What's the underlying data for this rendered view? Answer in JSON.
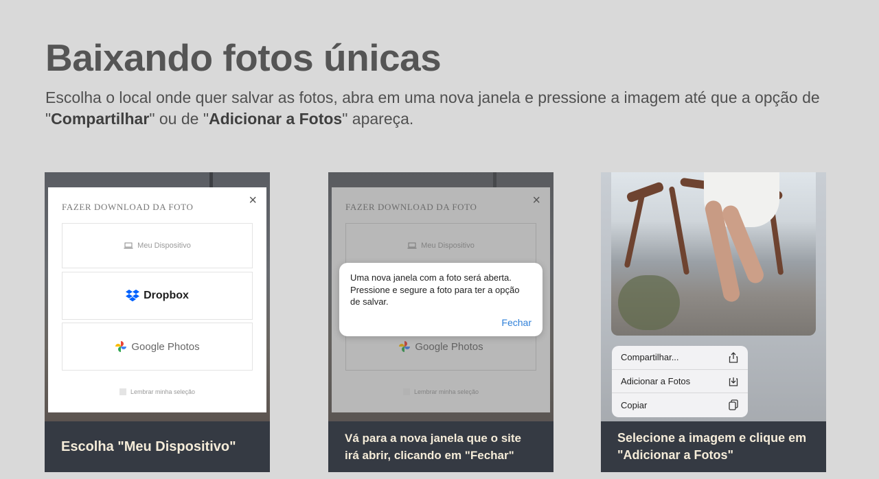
{
  "header": {
    "title": "Baixando fotos únicas",
    "subtitle_part1": "Escolha o local onde quer salvar as fotos, abra em uma nova janela e pressione a imagem até que a opção de \"",
    "subtitle_bold1": "Compartilhar",
    "subtitle_part2": "\" ou de \"",
    "subtitle_bold2": "Adicionar a Fotos",
    "subtitle_part3": "\" apareça."
  },
  "dialog": {
    "title": "FAZER DOWNLOAD DA FOTO",
    "close_icon": "×",
    "options": [
      {
        "label": "Meu Dispositivo",
        "icon": "laptop-icon"
      },
      {
        "label": "Dropbox",
        "icon": "dropbox-icon"
      },
      {
        "label": "Google Photos",
        "icon": "google-photos-icon"
      }
    ],
    "remember_label": "Lembrar minha seleção"
  },
  "alert": {
    "message": "Uma nova janela com a foto será aberta. Pressione e segure a foto para ter a opção de salvar.",
    "button": "Fechar"
  },
  "share_menu": {
    "items": [
      {
        "label": "Compartilhar...",
        "icon": "share-icon"
      },
      {
        "label": "Adicionar a Fotos",
        "icon": "save-to-photos-icon"
      },
      {
        "label": "Copiar",
        "icon": "copy-icon"
      }
    ]
  },
  "captions": [
    "Escolha \"Meu Dispositivo\"",
    "Vá para a nova janela que o site irá abrir, clicando em \"Fechar\"",
    "Selecione a imagem e clique em \"Adicionar a Fotos\""
  ],
  "colors": {
    "background": "#d9d9d9",
    "caption_bg": "#353a43",
    "caption_text": "#f5ecd9",
    "link_blue": "#2f80d9",
    "dropbox_blue": "#0061fe"
  }
}
